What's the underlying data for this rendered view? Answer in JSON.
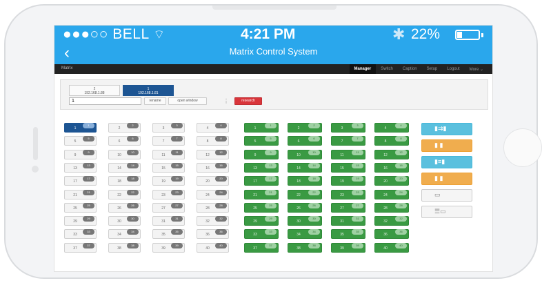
{
  "status_bar": {
    "carrier": "●●●○○ BELL",
    "wifi": "wifi-icon",
    "time": "4:21 PM",
    "battery": "22%",
    "battery_level": 0.22,
    "bluetooth": "bluetooth-icon"
  },
  "nav_bar": {
    "back": "‹",
    "title": "Matrix Control System"
  },
  "app_bar": {
    "brand": "Matrix",
    "menu": [
      "Manager",
      "Switch",
      "Caption",
      "Setup",
      "Logout",
      "More ⌄"
    ],
    "active": "Manager"
  },
  "devices": [
    {
      "num": "2",
      "ip": "192.168.1.88",
      "selected": false
    },
    {
      "num": "1",
      "ip": "192.168.1.81",
      "selected": true
    }
  ],
  "controls": {
    "name_value": "1",
    "rename": "rename",
    "open_window": "open window",
    "kebab": "⋮",
    "research": "research"
  },
  "inputs": {
    "labels": [
      "1",
      "2",
      "3",
      "4",
      "5",
      "6",
      "7",
      "8",
      "9",
      "10",
      "11",
      "12",
      "13",
      "14",
      "15",
      "16",
      "17",
      "18",
      "19",
      "20",
      "21",
      "22",
      "23",
      "24",
      "25",
      "26",
      "27",
      "28",
      "29",
      "30",
      "31",
      "32",
      "33",
      "34",
      "35",
      "36",
      "37",
      "38",
      "39",
      "40"
    ],
    "badges": [
      "1",
      "2",
      "3",
      "4",
      "5",
      "6",
      "7",
      "8",
      "9",
      "10",
      "11",
      "12",
      "13",
      "14",
      "15",
      "16",
      "17",
      "18",
      "19",
      "20",
      "21",
      "22",
      "23",
      "24",
      "25",
      "26",
      "27",
      "28",
      "29",
      "30",
      "31",
      "32",
      "33",
      "34",
      "35",
      "36",
      "37",
      "38",
      "39",
      "40"
    ],
    "selected_index": 0
  },
  "outputs": {
    "labels": [
      "1",
      "2",
      "3",
      "4",
      "5",
      "6",
      "7",
      "8",
      "9",
      "10",
      "11",
      "12",
      "13",
      "14",
      "15",
      "16",
      "17",
      "18",
      "19",
      "20",
      "21",
      "22",
      "23",
      "24",
      "25",
      "26",
      "27",
      "28",
      "29",
      "30",
      "31",
      "32",
      "33",
      "34",
      "35",
      "36",
      "37",
      "38",
      "39",
      "40"
    ],
    "badges": [
      "1",
      "2",
      "3",
      "4",
      "5",
      "6",
      "7",
      "8",
      "9",
      "10",
      "11",
      "12",
      "13",
      "14",
      "15",
      "16",
      "17",
      "18",
      "19",
      "20",
      "21",
      "22",
      "23",
      "24",
      "25",
      "26",
      "27",
      "28",
      "29",
      "30",
      "31",
      "32",
      "33",
      "34",
      "35",
      "36",
      "37",
      "38",
      "39",
      "40"
    ]
  },
  "side_buttons": [
    {
      "color": "blue",
      "icon": "one-to-many-icon"
    },
    {
      "color": "orange",
      "icon": "one-to-one-icon"
    },
    {
      "color": "blue",
      "icon": "all-to-all-icon"
    },
    {
      "color": "orange",
      "icon": "clear-pairs-icon"
    },
    {
      "color": "grey",
      "icon": "save-icon"
    },
    {
      "color": "grey",
      "icon": "load-icon"
    }
  ]
}
